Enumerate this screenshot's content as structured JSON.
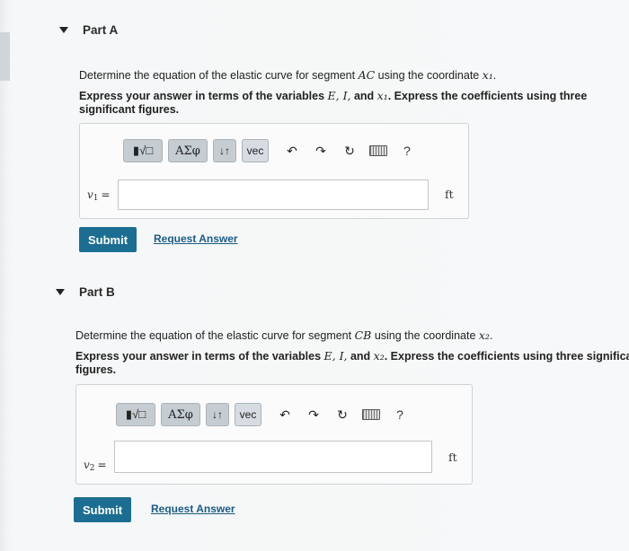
{
  "partA": {
    "title": "Part A",
    "prompt_pre": "Determine the equation of the elastic curve for segment ",
    "prompt_segment": "AC",
    "prompt_mid": " using the coordinate ",
    "prompt_var": "x₁",
    "prompt_post": ".",
    "instruction_pre": "Express your answer in terms of the variables ",
    "instruction_vars": "E, I,",
    "instruction_and": " and ",
    "instruction_var2": "x₁",
    "instruction_post": ". Express the coefficients using three significant figures.",
    "toolbar": {
      "templates_label": "▮√□",
      "greek_label": "ΑΣφ",
      "arrows_label": "↓↑",
      "vec_label": "vec",
      "undo_glyph": "↶",
      "redo_glyph": "↷",
      "reset_glyph": "↻",
      "help_glyph": "?"
    },
    "var_name": "v",
    "var_sub": "1",
    "var_eq": "=",
    "input_value": "",
    "unit": "ft",
    "submit_label": "Submit",
    "request_label": "Request Answer"
  },
  "partB": {
    "title": "Part B",
    "prompt_pre": "Determine the equation of the elastic curve for segment ",
    "prompt_segment": "CB",
    "prompt_mid": " using the coordinate ",
    "prompt_var": "x₂",
    "prompt_post": ".",
    "instruction_pre": "Express your answer in terms of the variables ",
    "instruction_vars": "E, I,",
    "instruction_and": " and ",
    "instruction_var2": "x₂",
    "instruction_post": ". Express the coefficients using three significan",
    "instruction_line2": "figures.",
    "toolbar": {
      "templates_label": "▮√□",
      "greek_label": "ΑΣφ",
      "arrows_label": "↓↑",
      "vec_label": "vec",
      "undo_glyph": "↶",
      "redo_glyph": "↷",
      "reset_glyph": "↻",
      "help_glyph": "?"
    },
    "var_name": "v",
    "var_sub": "2",
    "var_eq": "=",
    "input_value": "",
    "unit": "ft",
    "submit_label": "Submit",
    "request_label": "Request Answer"
  },
  "colors": {
    "submit_bg": "#1b6e92",
    "link": "#1a5b85",
    "toolbar_btn": "#c5ccd2"
  }
}
